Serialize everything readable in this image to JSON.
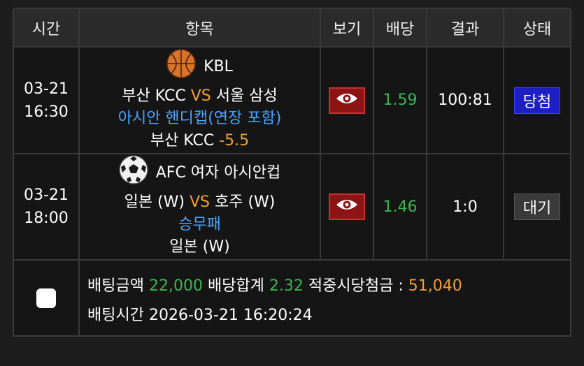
{
  "headers": {
    "time": "시간",
    "item": "항목",
    "view": "보기",
    "odds": "배당",
    "result": "결과",
    "status": "상태"
  },
  "rows": [
    {
      "date": "03-21",
      "time": "16:30",
      "sport_icon": "basketball-icon",
      "league": "KBL",
      "home": "부산 KCC",
      "vs": "VS",
      "away": "서울 삼성",
      "market": "아시안 핸디캡(연장 포함)",
      "pick": "부산 KCC",
      "pick_value": "-5.5",
      "odds": "1.59",
      "result": "100:81",
      "status": "당첨"
    },
    {
      "date": "03-21",
      "time": "18:00",
      "sport_icon": "soccer-ball-icon",
      "league": "AFC 여자 아시안컵",
      "home": "일본 (W)",
      "vs": "VS",
      "away": "호주 (W)",
      "market": "승무패",
      "pick": "일본 (W)",
      "pick_value": "",
      "odds": "1.46",
      "result": "1:0",
      "status": "대기"
    }
  ],
  "summary": {
    "bet_amount_label": "배팅금액",
    "bet_amount": "22,000",
    "total_odds_label": "배당합계",
    "total_odds": "2.32",
    "payout_label": "적중시당첨금 :",
    "payout": "51,040",
    "bet_time_label": "배팅시간",
    "bet_time": "2026-03-21 16:20:24"
  },
  "colors": {
    "win_status": "#1d1ec4",
    "wait_status": "#3a3a3a",
    "odds_green": "#38b550",
    "vs_orange": "#f0a030",
    "market_blue": "#4aa3ff"
  }
}
